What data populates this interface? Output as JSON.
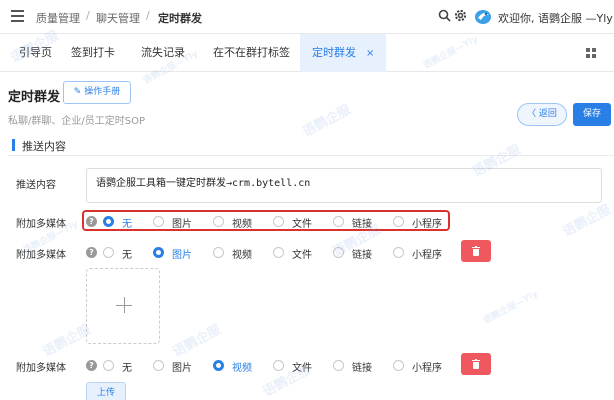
{
  "topbar": {
    "breadcrumbs": [
      "质量管理",
      "聊天管理",
      "定时群发"
    ],
    "separator": "/",
    "welcome": "欢迎你, 语鹦企服 —Yly"
  },
  "tabs": [
    {
      "label": "引导页"
    },
    {
      "label": "签到打卡"
    },
    {
      "label": "流失记录"
    },
    {
      "label": "在不在群打标签"
    },
    {
      "label": "定时群发",
      "close": "×"
    }
  ],
  "header": {
    "title": "定时群发",
    "manual_label": "✎ 操作手册",
    "subtitle": "私聊/群聊、企业/员工定时SOP",
    "back_label": "〈 返回",
    "save_label": "保存"
  },
  "section": {
    "title": "推送内容",
    "content_label": "推送内容",
    "content_value": "语鹦企服工具箱一键定时群发→crm.bytell.cn"
  },
  "media": {
    "label": "附加多媒体",
    "help": "?",
    "options": [
      "无",
      "图片",
      "视频",
      "文件",
      "链接",
      "小程序"
    ],
    "rows": [
      {
        "selected": 0
      },
      {
        "selected": 1
      },
      {
        "selected": 2
      }
    ],
    "upload_label": "上传"
  },
  "watermark": {
    "text": "语鹦企服",
    "small": "语鹦企服—Yly"
  },
  "colors": {
    "accent": "#2a7fe6",
    "danger": "#f0585f",
    "highlight": "#d9322e"
  }
}
